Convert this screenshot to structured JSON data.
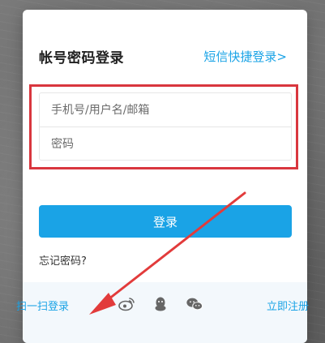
{
  "login_card": {
    "title": "帐号密码登录",
    "sms_login_link": "短信快捷登录>",
    "username_placeholder": "手机号/用户名/邮箱",
    "password_placeholder": "密码",
    "login_button": "登录",
    "forgot_password": "忘记密码?",
    "qr_login": "扫一扫登录",
    "register": "立即注册",
    "social_icons": [
      "weibo-icon",
      "qq-icon",
      "wechat-icon"
    ]
  },
  "colors": {
    "accent": "#1aa3e6",
    "highlight": "#d9363e",
    "arrow": "#e23b3b",
    "footer_bg": "#f3f8fc"
  }
}
